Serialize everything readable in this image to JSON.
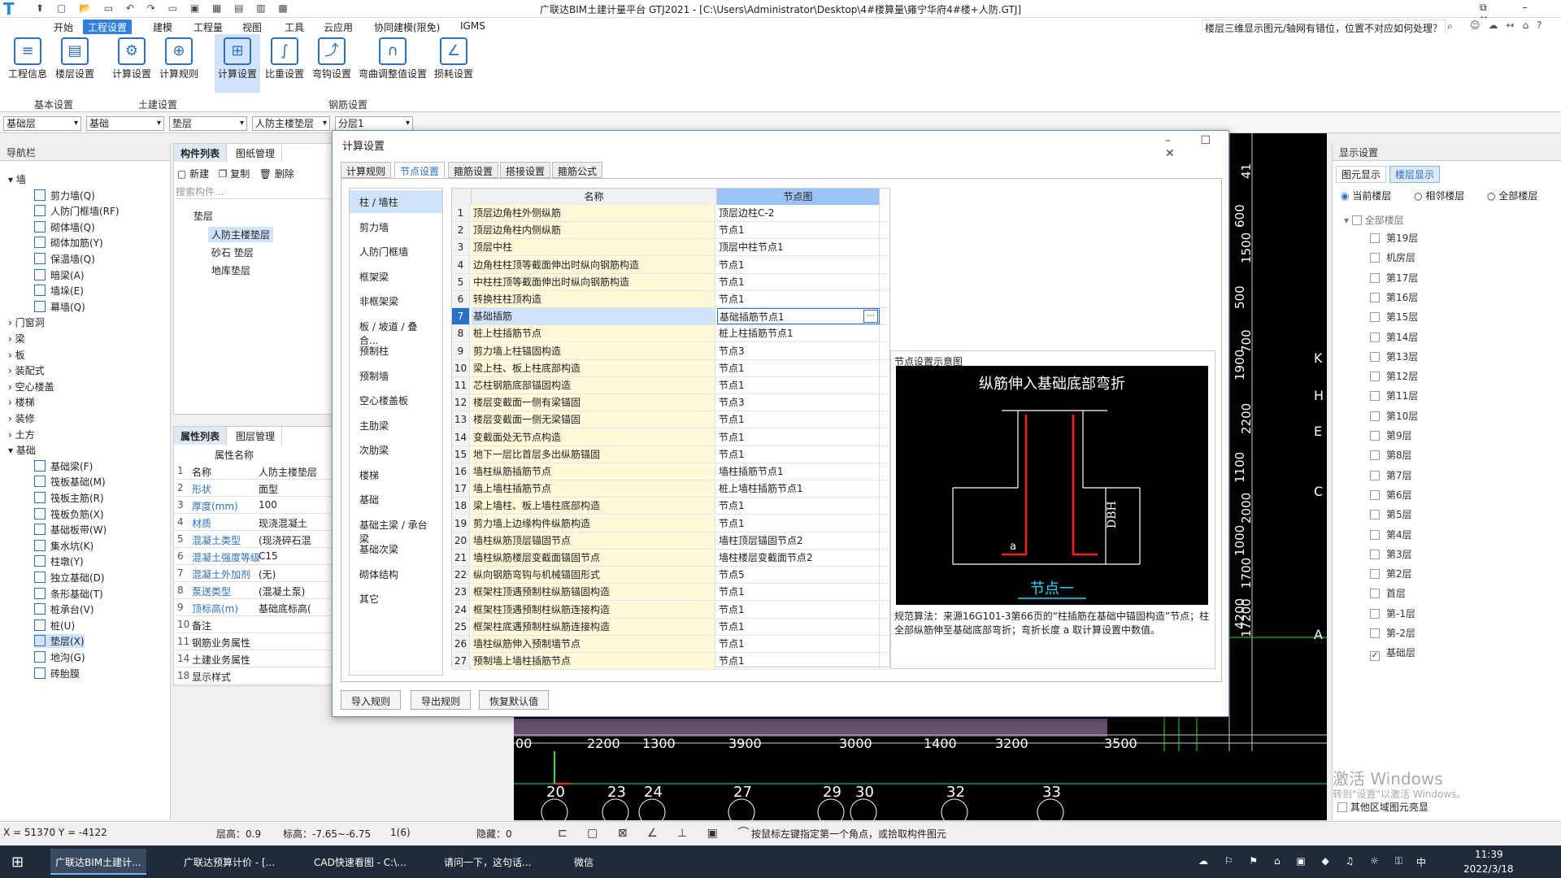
{
  "titlebar": {
    "title": "广联达BIM土建计量平台 GTJ2021 - [C:\\Users\\Administrator\\Desktop\\4#楼算量\\雍宁华府4#楼+人防.GTJ]",
    "help_search": "楼层三维显示图元/轴网有错位，位置不对应如何处理？"
  },
  "menu": [
    "开始",
    "工程设置",
    "建模",
    "工程量",
    "视图",
    "工具",
    "云应用",
    "协同建模(限免)",
    "IGMS"
  ],
  "ribbon": {
    "buttons": [
      "工程信息",
      "楼层设置",
      "计算设置",
      "计算规则",
      "计算设置",
      "比重设置",
      "弯钩设置",
      "弯曲调整值设置",
      "损耗设置"
    ],
    "groups": [
      "基本设置",
      "土建设置",
      "钢筋设置"
    ]
  },
  "selectors": [
    "基础层",
    "基础",
    "垫层",
    "人防主楼垫层",
    "分层1"
  ],
  "nav": {
    "title": "导航栏",
    "items": [
      "墙",
      "剪力墙(Q)",
      "人防门框墙(RF)",
      "砌体墙(Q)",
      "砌体加筋(Y)",
      "保温墙(Q)",
      "暗梁(A)",
      "墙垛(E)",
      "幕墙(Q)",
      "门窗洞",
      "梁",
      "板",
      "装配式",
      "空心楼盖",
      "楼梯",
      "装修",
      "土方",
      "基础",
      "基础梁(F)",
      "筏板基础(M)",
      "筏板主筋(R)",
      "筏板负筋(X)",
      "基础板带(W)",
      "集水坑(K)",
      "柱墩(Y)",
      "独立基础(D)",
      "条形基础(T)",
      "桩承台(V)",
      "桩(U)",
      "垫层(X)",
      "地沟(G)",
      "砖胎膜"
    ]
  },
  "complist": {
    "tabs": [
      "构件列表",
      "图纸管理"
    ],
    "toolbar": [
      "新建",
      "复制",
      "删除"
    ],
    "search": "搜索构件...",
    "group": "垫层",
    "items": [
      "人防主楼垫层",
      "砂石 垫层",
      "地库垫层"
    ]
  },
  "proplist": {
    "tabs": [
      "属性列表",
      "图层管理"
    ],
    "header": "属性名称",
    "rows": [
      [
        "1",
        "名称",
        "人防主楼垫层"
      ],
      [
        "2",
        "形状",
        "面型"
      ],
      [
        "3",
        "厚度(mm)",
        "100"
      ],
      [
        "4",
        "材质",
        "现浇混凝土"
      ],
      [
        "5",
        "混凝土类型",
        "(现浇碎石混"
      ],
      [
        "6",
        "混凝土强度等级",
        "C15"
      ],
      [
        "7",
        "混凝土外加剂",
        "(无)"
      ],
      [
        "8",
        "泵送类型",
        "(混凝土泵)"
      ],
      [
        "9",
        "顶标高(m)",
        "基础底标高("
      ],
      [
        "10",
        "备注",
        ""
      ],
      [
        "11",
        "钢筋业务属性",
        ""
      ],
      [
        "14",
        "土建业务属性",
        ""
      ],
      [
        "18",
        "显示样式",
        ""
      ]
    ]
  },
  "dialog": {
    "title": "计算设置",
    "tabs": [
      "计算规则",
      "节点设置",
      "箍筋设置",
      "搭接设置",
      "箍筋公式"
    ],
    "categories": [
      "柱 / 墙柱",
      "剪力墙",
      "人防门框墙",
      "框架梁",
      "非框架梁",
      "板 / 坡道 / 叠合...",
      "预制柱",
      "预制墙",
      "空心楼盖板",
      "主肋梁",
      "次肋梁",
      "楼梯",
      "基础",
      "基础主梁 / 承台梁",
      "基础次梁",
      "砌体结构",
      "其它"
    ],
    "grid_headers": [
      "名称",
      "节点图"
    ],
    "rows": [
      [
        "1",
        "顶层边角柱外侧纵筋",
        "顶层边柱C-2"
      ],
      [
        "2",
        "顶层边角柱内侧纵筋",
        "节点1"
      ],
      [
        "3",
        "顶层中柱",
        "顶层中柱节点1"
      ],
      [
        "4",
        "边角柱柱顶等截面伸出时纵向钢筋构造",
        "节点1"
      ],
      [
        "5",
        "中柱柱顶等截面伸出时纵向钢筋构造",
        "节点1"
      ],
      [
        "6",
        "转换柱柱顶构造",
        "节点1"
      ],
      [
        "7",
        "基础插筋",
        "基础插筋节点1"
      ],
      [
        "8",
        "桩上柱插筋节点",
        "桩上柱插筋节点1"
      ],
      [
        "9",
        "剪力墙上柱锚固构造",
        "节点3"
      ],
      [
        "10",
        "梁上柱、板上柱底部构造",
        "节点1"
      ],
      [
        "11",
        "芯柱钢筋底部锚固构造",
        "节点1"
      ],
      [
        "12",
        "楼层变截面一侧有梁锚固",
        "节点3"
      ],
      [
        "13",
        "楼层变截面一侧无梁锚固",
        "节点1"
      ],
      [
        "14",
        "变截面处无节点构造",
        "节点1"
      ],
      [
        "15",
        "地下一层比首层多出纵筋锚固",
        "节点1"
      ],
      [
        "16",
        "墙柱纵筋插筋节点",
        "墙柱插筋节点1"
      ],
      [
        "17",
        "墙上墙柱插筋节点",
        "桩上墙柱插筋节点1"
      ],
      [
        "18",
        "梁上墙柱、板上墙柱底部构造",
        "节点1"
      ],
      [
        "19",
        "剪力墙上边缘构件纵筋构造",
        "节点1"
      ],
      [
        "20",
        "墙柱纵筋顶层锚固节点",
        "墙柱顶层锚固节点2"
      ],
      [
        "21",
        "墙柱纵筋楼层变截面锚固节点",
        "墙柱楼层变截面节点2"
      ],
      [
        "22",
        "纵向钢筋弯钩与机械锚固形式",
        "节点5"
      ],
      [
        "23",
        "框架柱顶遇预制柱纵筋锚固构造",
        "节点1"
      ],
      [
        "24",
        "框架柱顶遇预制柱纵筋连接构造",
        "节点1"
      ],
      [
        "25",
        "框架柱底遇预制柱纵筋连接构造",
        "节点1"
      ],
      [
        "26",
        "墙柱纵筋伸入预制墙节点",
        "节点1"
      ],
      [
        "27",
        "预制墙上墙柱插筋节点",
        "节点1"
      ]
    ],
    "preview_title": "节点设置示意图",
    "diagram_title": "纵筋伸入基础底部弯折",
    "diagram_label_dbh": "DBH",
    "diagram_label_a": "a",
    "diagram_caption": "节点一",
    "preview_note": "规范算法：来源16G101-3第66页的“柱插筋在基础中锚固构造”节点；柱全部纵筋伸至基础底部弯折；弯折长度 a 取计算设置中数值。",
    "buttons": [
      "导入规则",
      "导出规则",
      "恢复默认值"
    ]
  },
  "cad": {
    "dims_bottom": [
      "00",
      "2200",
      "1300",
      "3900",
      "3000",
      "1400",
      "3200",
      "3500"
    ],
    "axes_bottom": [
      "20",
      "23",
      "24",
      "27",
      "29",
      "30",
      "32",
      "33"
    ],
    "dims_left": [
      "41",
      "600",
      "1500",
      "500",
      "700",
      "1900",
      "2200",
      "1100",
      "2000",
      "1000",
      "1700",
      "4200",
      "17200"
    ],
    "axes_right": [
      "K",
      "H",
      "E",
      "C",
      "A"
    ]
  },
  "display": {
    "title": "显示设置",
    "tabs": [
      "图元显示",
      "楼层显示"
    ],
    "radios": [
      "当前楼层",
      "相邻楼层",
      "全部楼层"
    ],
    "root": "全部楼层",
    "floors": [
      "第19层",
      "机房层",
      "第17层",
      "第16层",
      "第15层",
      "第14层",
      "第13层",
      "第12层",
      "第11层",
      "第10层",
      "第9层",
      "第8层",
      "第7层",
      "第6层",
      "第5层",
      "第4层",
      "第3层",
      "第2层",
      "首层",
      "第-1层",
      "第-2层",
      "基础层"
    ],
    "checked_floor": "基础层",
    "footer": "其他区域图元亮显",
    "watermark1": "激活 Windows",
    "watermark2": "转到\"设置\"以激活 Windows。"
  },
  "status": {
    "coords": "X = 51370 Y = -4122",
    "floor_h": "层高：0.9",
    "elev": "标高：-7.65~-6.75",
    "count": "1(6)",
    "hidden": "隐藏：0",
    "hint": "按鼠标左键指定第一个角点，或拾取构件图元"
  },
  "taskbar": {
    "apps": [
      "广联达BIM土建计...",
      "广联达预算计价 - [...",
      "CAD快速看图 - C:\\...",
      "请问一下，这句话...",
      "微信"
    ],
    "time": "11:39",
    "date": "2022/3/18",
    "ime": "中"
  },
  "colors": {
    "accent": "#2a6fc9",
    "cad_bg": "#000000",
    "rebar": "#ff2020",
    "taskbar": "#1f2a3a"
  }
}
